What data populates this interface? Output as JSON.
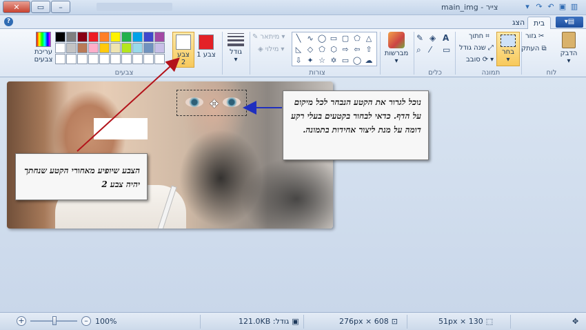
{
  "window": {
    "title": "צייר - main_img",
    "blurred_title": "Windows XP Home Edition",
    "buttons": {
      "close": "✕",
      "maximize": "▭",
      "minimize": "–"
    }
  },
  "tabs": {
    "file": "▾▤",
    "home": "בית",
    "view": "הצג",
    "help": "?"
  },
  "ribbon": {
    "clipboard": {
      "label": "לוח",
      "paste": "הדבק",
      "cut": "גזור",
      "copy": "העתק"
    },
    "image": {
      "label": "תמונה",
      "select": "בחר",
      "crop": "חתוך",
      "resize": "שנה גודל",
      "rotate": "סובב"
    },
    "tools": {
      "label": "כלים"
    },
    "brushes": {
      "label": "מברשות"
    },
    "shapes": {
      "label": "צורות",
      "outline": "מיתאר",
      "fill": "מילוי"
    },
    "size": {
      "label": "גודל"
    },
    "colors": {
      "label": "צבעים",
      "color1": "צבע 1",
      "color2_line1": "צבע",
      "color2_line2": "2",
      "edit_line1": "עריכת",
      "edit_line2": "צבעים",
      "color1_value": "#e32127",
      "color2_value": "#ffffff",
      "palette": [
        "#000000",
        "#7f7f7f",
        "#880015",
        "#ed1c24",
        "#ff7f27",
        "#fff200",
        "#22b14c",
        "#00a2e8",
        "#3f48cc",
        "#a349a4",
        "#ffffff",
        "#c3c3c3",
        "#b97a57",
        "#ffaec9",
        "#ffc90e",
        "#efe4b0",
        "#b5e61d",
        "#99d9ea",
        "#7092be",
        "#c8bfe7",
        "#ffffff",
        "#ffffff",
        "#ffffff",
        "#ffffff",
        "#ffffff",
        "#ffffff",
        "#ffffff",
        "#ffffff",
        "#ffffff",
        "#ffffff"
      ]
    }
  },
  "callouts": {
    "right": "נוכל לגרור את הקטע הנבחר לכל מיקום על הדף.  כדאי לבחור בקטעים בעלי רקע דומה על מנת ליצור אחידות בתמונה.",
    "left": "הצבע שיופיע מאחורי הקטע שנחתך יהיה צבע 2"
  },
  "status": {
    "selection_size": "130 × 51px",
    "image_size": "608 × 276px",
    "file_size": "גודל: 121.0KB",
    "zoom": "100%"
  }
}
